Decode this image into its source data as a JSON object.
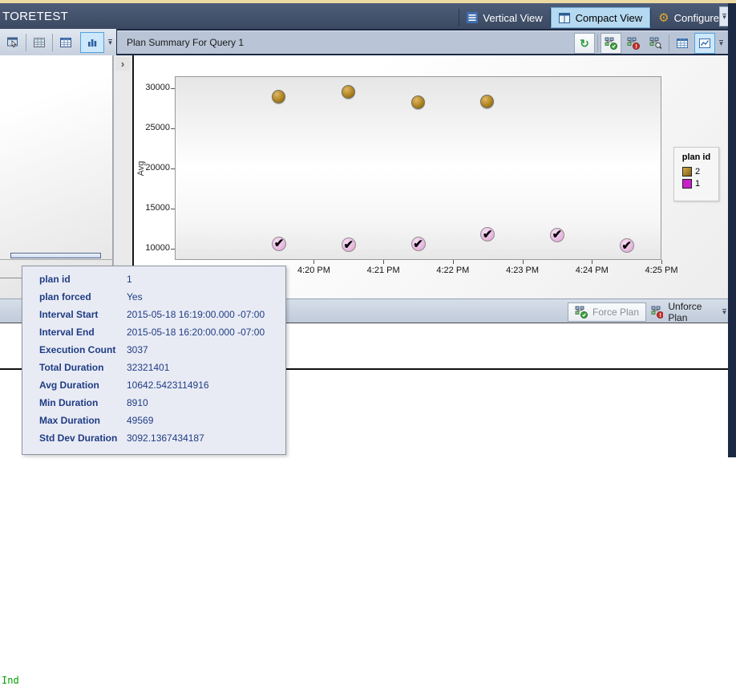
{
  "titlebar": {
    "title": "TORETEST",
    "buttons": [
      {
        "label": "Vertical View",
        "icon": "vertical-view-icon",
        "selected": false
      },
      {
        "label": "Compact View",
        "icon": "compact-view-icon",
        "selected": true
      },
      {
        "label": "Configure",
        "icon": "configure-gear-icon",
        "selected": false
      }
    ]
  },
  "left_toolbar": {
    "icons": [
      "query-plan-window-icon",
      "grid-results-icon",
      "table-view-icon",
      "bar-chart-view-icon"
    ],
    "selected": "bar-chart-view-icon"
  },
  "panel_header": {
    "title": "Plan Summary For Query 1",
    "icons": [
      "refresh-icon",
      "force-plan-icon",
      "unforce-plan-icon",
      "view-plan-icon",
      "grid-view-icon",
      "chart-view-icon"
    ],
    "selected": [
      "force-plan-icon",
      "chart-view-icon"
    ]
  },
  "chart_data": {
    "type": "scatter",
    "title": "",
    "xlabel": "",
    "x_axis": {
      "unit": "minutes after 4:19 PM",
      "lim": [
        -1,
        6
      ],
      "ticks": [
        {
          "x": 1,
          "label": "4:20 PM"
        },
        {
          "x": 2,
          "label": "4:21 PM"
        },
        {
          "x": 3,
          "label": "4:22 PM"
        },
        {
          "x": 4,
          "label": "4:23 PM"
        },
        {
          "x": 5,
          "label": "4:24 PM"
        },
        {
          "x": 6,
          "label": "4:25 PM"
        }
      ]
    },
    "y_axis": {
      "label": "Avg",
      "lim": [
        8600,
        31500
      ],
      "ticks": [
        10000,
        15000,
        20000,
        25000,
        30000
      ]
    },
    "legend": {
      "title": "plan id",
      "position": "right",
      "items": [
        {
          "label": "2",
          "color": "#a87b1e",
          "swatch": "brown-gradient"
        },
        {
          "label": "1",
          "color": "#cb1fcb",
          "swatch": "magenta"
        }
      ]
    },
    "series": [
      {
        "name": "2",
        "marker": "circle",
        "points": [
          {
            "x": 0.5,
            "y": 28900
          },
          {
            "x": 1.5,
            "y": 29500
          },
          {
            "x": 2.5,
            "y": 28250
          },
          {
            "x": 3.5,
            "y": 28300
          }
        ]
      },
      {
        "name": "1",
        "marker": "check-circle",
        "check_glyph": "✔",
        "points": [
          {
            "x": 0.5,
            "y": 10642
          },
          {
            "x": 1.5,
            "y": 10500
          },
          {
            "x": 2.5,
            "y": 10600
          },
          {
            "x": 3.5,
            "y": 11800
          },
          {
            "x": 4.5,
            "y": 11750
          },
          {
            "x": 5.5,
            "y": 10400
          }
        ]
      }
    ]
  },
  "tooltip": {
    "rows": [
      {
        "label": "plan id",
        "value": "1"
      },
      {
        "label": "plan forced",
        "value": "Yes"
      },
      {
        "label": "Interval Start",
        "value": "2015-05-18 16:19:00.000 -07:00"
      },
      {
        "label": "Interval End",
        "value": "2015-05-18 16:20:00.000 -07:00"
      },
      {
        "label": "Execution Count",
        "value": "3037"
      },
      {
        "label": "Total Duration",
        "value": "32321401"
      },
      {
        "label": "Avg Duration",
        "value": "10642.5423114916"
      },
      {
        "label": "Min Duration",
        "value": "8910"
      },
      {
        "label": "Max Duration",
        "value": "49569"
      },
      {
        "label": "Std Dev Duration",
        "value": "3092.1367434187"
      }
    ]
  },
  "force_toolbar": {
    "force_label": "Force Plan",
    "force_enabled": false,
    "unforce_label": "Unforce Plan"
  },
  "query_pane": {
    "visible_text": "Ind"
  },
  "expander": {
    "glyph": "›"
  },
  "overflow_glyph": "▾",
  "colors": {
    "top_strip": "#ecd9a2",
    "titlebar": "#3f4d68",
    "selection_accent": "#b5d9f1",
    "plan2_brown": "#a87b1e",
    "plan1_magenta": "#cb1fcb",
    "tooltip_text": "#1e3c85",
    "query_text_green": "#00a000"
  }
}
